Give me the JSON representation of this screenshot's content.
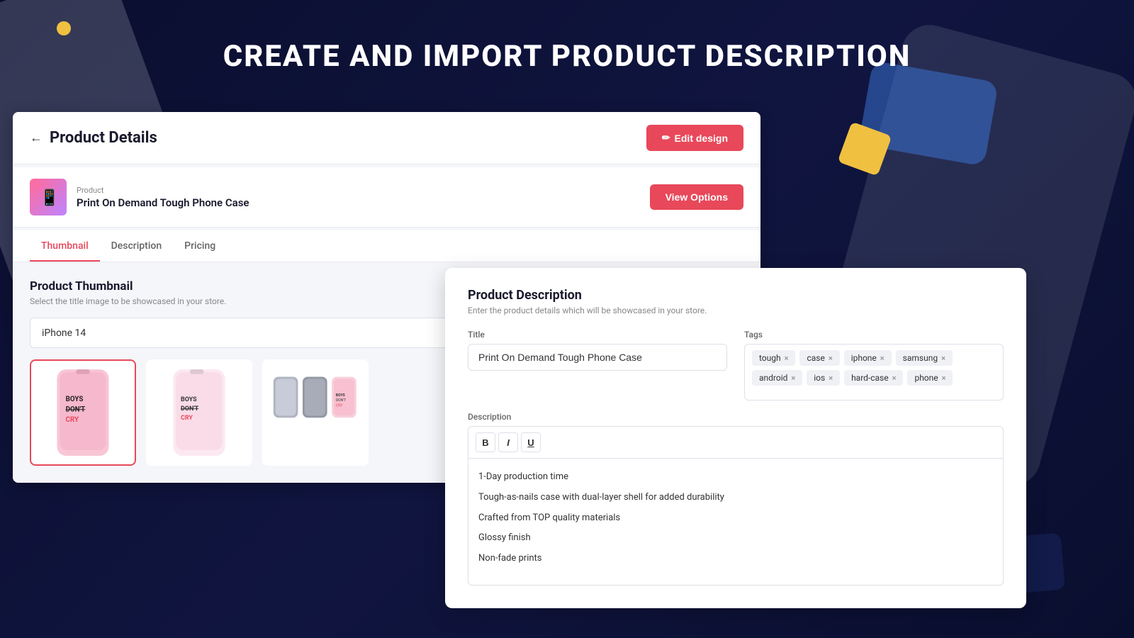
{
  "page": {
    "title": "CREATE AND IMPORT PRODUCT DESCRIPTION"
  },
  "product_details_card": {
    "header": {
      "back_label": "←",
      "title": "Product Details",
      "edit_btn": "Edit design",
      "edit_icon": "✏"
    },
    "product_bar": {
      "label": "Product",
      "name": "Print On Demand Tough Phone Case",
      "view_options_btn": "View Options"
    },
    "tabs": [
      {
        "label": "Thumbnail",
        "active": true
      },
      {
        "label": "Description",
        "active": false
      },
      {
        "label": "Pricing",
        "active": false
      }
    ],
    "thumbnail_section": {
      "title": "Product Thumbnail",
      "subtitle": "Select the title image to be showcased in your store.",
      "dropdown_value": "iPhone 14",
      "images": [
        {
          "id": "thumb-1",
          "selected": true
        },
        {
          "id": "thumb-2",
          "selected": false
        },
        {
          "id": "thumb-3",
          "selected": false
        }
      ]
    }
  },
  "product_desc_card": {
    "title": "Product Description",
    "subtitle": "Enter the product details which will be showcased in your store.",
    "title_label": "Title",
    "title_value": "Print On Demand Tough Phone Case",
    "tags_label": "Tags",
    "tags": [
      {
        "label": "tough",
        "id": "tag-tough"
      },
      {
        "label": "case",
        "id": "tag-case"
      },
      {
        "label": "iphone",
        "id": "tag-iphone"
      },
      {
        "label": "samsung",
        "id": "tag-samsung"
      },
      {
        "label": "android",
        "id": "tag-android"
      },
      {
        "label": "ios",
        "id": "tag-ios"
      },
      {
        "label": "hard-case",
        "id": "tag-hard-case"
      },
      {
        "label": "phone",
        "id": "tag-phone"
      }
    ],
    "description_label": "Description",
    "toolbar": {
      "bold": "B",
      "italic": "I",
      "underline": "U"
    },
    "description_lines": [
      "1-Day production time",
      "Tough-as-nails case with dual-layer shell for added durability",
      "Crafted from TOP quality materials",
      "Glossy finish",
      "Non-fade prints"
    ]
  },
  "colors": {
    "accent": "#e8485a",
    "dark_bg": "#0a0e2e",
    "text_primary": "#1a1a2e",
    "text_muted": "#888888"
  }
}
